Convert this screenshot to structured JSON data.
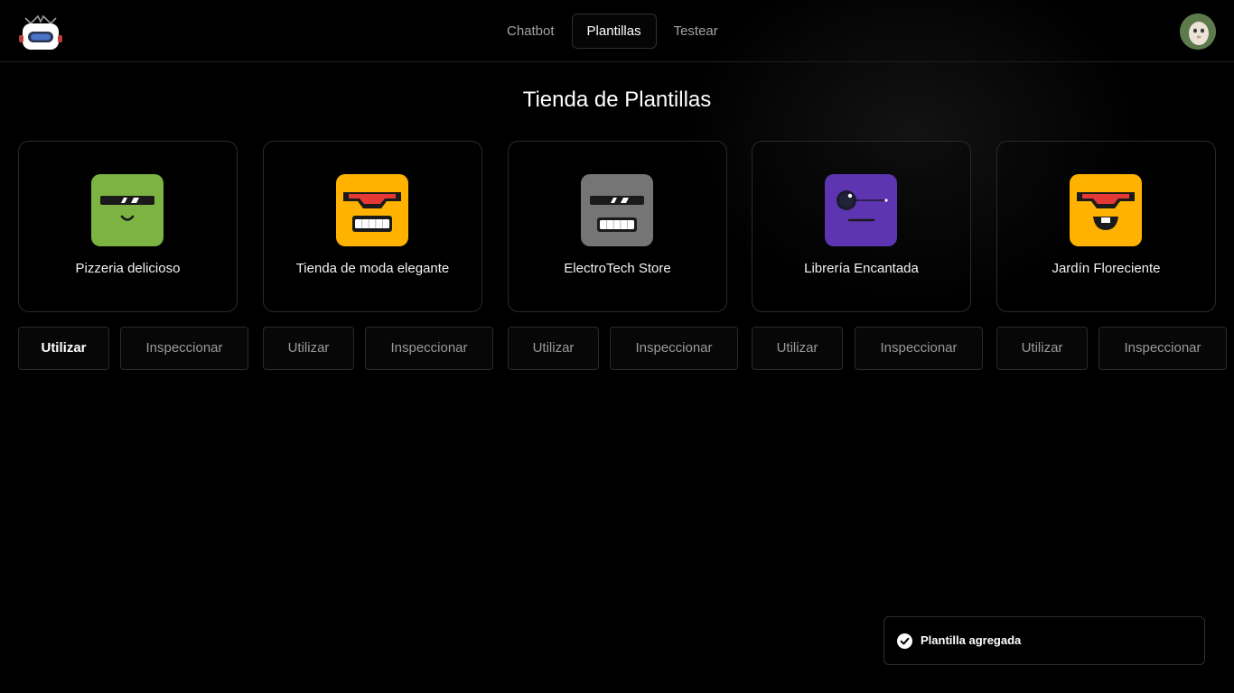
{
  "header": {
    "nav": [
      {
        "label": "Chatbot",
        "active": false
      },
      {
        "label": "Plantillas",
        "active": true
      },
      {
        "label": "Testear",
        "active": false
      }
    ]
  },
  "main": {
    "title": "Tienda de Plantillas",
    "templates": [
      {
        "name": "Pizzeria delicioso",
        "icon": "robot-face-visor-smile-icon",
        "color": "#7cb342",
        "use_label": "Utilizar",
        "inspect_label": "Inspeccionar"
      },
      {
        "name": "Tienda de moda elegante",
        "icon": "robot-face-red-visor-grin-icon",
        "color": "#ffb300",
        "use_label": "Utilizar",
        "inspect_label": "Inspeccionar"
      },
      {
        "name": "ElectroTech Store",
        "icon": "robot-face-visor-grin-icon",
        "color": "#757575",
        "use_label": "Utilizar",
        "inspect_label": "Inspeccionar"
      },
      {
        "name": "Librería Encantada",
        "icon": "robot-face-monocle-icon",
        "color": "#5e35b1",
        "use_label": "Utilizar",
        "inspect_label": "Inspeccionar"
      },
      {
        "name": "Jardín Floreciente",
        "icon": "robot-face-red-visor-tooth-icon",
        "color": "#ffb300",
        "use_label": "Utilizar",
        "inspect_label": "Inspeccionar"
      }
    ]
  },
  "toast": {
    "message": "Plantilla agregada",
    "icon": "check-circle-icon"
  }
}
